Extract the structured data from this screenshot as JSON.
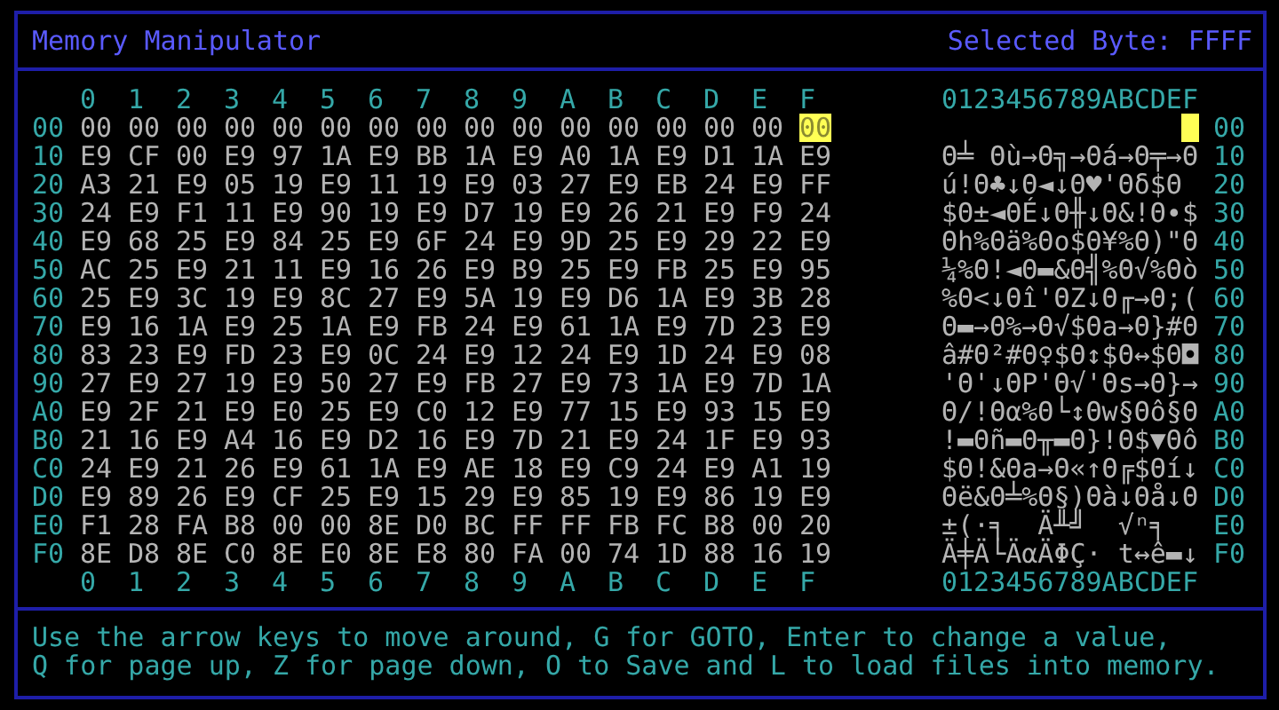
{
  "header": {
    "title": "Memory Manipulator",
    "selected_byte": "Selected Byte: FFFF"
  },
  "columns": [
    "0",
    "1",
    "2",
    "3",
    "4",
    "5",
    "6",
    "7",
    "8",
    "9",
    "A",
    "B",
    "C",
    "D",
    "E",
    "F"
  ],
  "ascii_header": "0123456789ABCDEF",
  "rows": [
    {
      "label": "00",
      "right_label": "00",
      "ascii": "                ",
      "bytes": [
        {
          "hex": "00",
          "selected": false
        },
        {
          "hex": "00",
          "selected": false
        },
        {
          "hex": "00",
          "selected": false
        },
        {
          "hex": "00",
          "selected": false
        },
        {
          "hex": "00",
          "selected": false
        },
        {
          "hex": "00",
          "selected": false
        },
        {
          "hex": "00",
          "selected": false
        },
        {
          "hex": "00",
          "selected": false
        },
        {
          "hex": "00",
          "selected": false
        },
        {
          "hex": "00",
          "selected": false
        },
        {
          "hex": "00",
          "selected": false
        },
        {
          "hex": "00",
          "selected": false
        },
        {
          "hex": "00",
          "selected": false
        },
        {
          "hex": "00",
          "selected": false
        },
        {
          "hex": "00",
          "selected": false
        },
        {
          "hex": "00",
          "selected": true
        }
      ]
    },
    {
      "label": "10",
      "right_label": "10",
      "ascii": "Θ╧ Θù→Θ╗→Θá→Θ╤→Θ",
      "bytes": [
        {
          "hex": "E9",
          "selected": false
        },
        {
          "hex": "CF",
          "selected": false
        },
        {
          "hex": "00",
          "selected": false
        },
        {
          "hex": "E9",
          "selected": false
        },
        {
          "hex": "97",
          "selected": false
        },
        {
          "hex": "1A",
          "selected": false
        },
        {
          "hex": "E9",
          "selected": false
        },
        {
          "hex": "BB",
          "selected": false
        },
        {
          "hex": "1A",
          "selected": false
        },
        {
          "hex": "E9",
          "selected": false
        },
        {
          "hex": "A0",
          "selected": false
        },
        {
          "hex": "1A",
          "selected": false
        },
        {
          "hex": "E9",
          "selected": false
        },
        {
          "hex": "D1",
          "selected": false
        },
        {
          "hex": "1A",
          "selected": false
        },
        {
          "hex": "E9",
          "selected": false
        }
      ]
    },
    {
      "label": "20",
      "right_label": "20",
      "ascii": "ú!Θ♣↓Θ◄↓Θ♥'Θδ$Θ ",
      "bytes": [
        {
          "hex": "A3",
          "selected": false
        },
        {
          "hex": "21",
          "selected": false
        },
        {
          "hex": "E9",
          "selected": false
        },
        {
          "hex": "05",
          "selected": false
        },
        {
          "hex": "19",
          "selected": false
        },
        {
          "hex": "E9",
          "selected": false
        },
        {
          "hex": "11",
          "selected": false
        },
        {
          "hex": "19",
          "selected": false
        },
        {
          "hex": "E9",
          "selected": false
        },
        {
          "hex": "03",
          "selected": false
        },
        {
          "hex": "27",
          "selected": false
        },
        {
          "hex": "E9",
          "selected": false
        },
        {
          "hex": "EB",
          "selected": false
        },
        {
          "hex": "24",
          "selected": false
        },
        {
          "hex": "E9",
          "selected": false
        },
        {
          "hex": "FF",
          "selected": false
        }
      ]
    },
    {
      "label": "30",
      "right_label": "30",
      "ascii": "$Θ±◄ΘÉ↓Θ╫↓Θ&!Θ∙$",
      "bytes": [
        {
          "hex": "24",
          "selected": false
        },
        {
          "hex": "E9",
          "selected": false
        },
        {
          "hex": "F1",
          "selected": false
        },
        {
          "hex": "11",
          "selected": false
        },
        {
          "hex": "E9",
          "selected": false
        },
        {
          "hex": "90",
          "selected": false
        },
        {
          "hex": "19",
          "selected": false
        },
        {
          "hex": "E9",
          "selected": false
        },
        {
          "hex": "D7",
          "selected": false
        },
        {
          "hex": "19",
          "selected": false
        },
        {
          "hex": "E9",
          "selected": false
        },
        {
          "hex": "26",
          "selected": false
        },
        {
          "hex": "21",
          "selected": false
        },
        {
          "hex": "E9",
          "selected": false
        },
        {
          "hex": "F9",
          "selected": false
        },
        {
          "hex": "24",
          "selected": false
        }
      ]
    },
    {
      "label": "40",
      "right_label": "40",
      "ascii": "Θh%Θä%Θo$Θ¥%Θ)\"Θ",
      "bytes": [
        {
          "hex": "E9",
          "selected": false
        },
        {
          "hex": "68",
          "selected": false
        },
        {
          "hex": "25",
          "selected": false
        },
        {
          "hex": "E9",
          "selected": false
        },
        {
          "hex": "84",
          "selected": false
        },
        {
          "hex": "25",
          "selected": false
        },
        {
          "hex": "E9",
          "selected": false
        },
        {
          "hex": "6F",
          "selected": false
        },
        {
          "hex": "24",
          "selected": false
        },
        {
          "hex": "E9",
          "selected": false
        },
        {
          "hex": "9D",
          "selected": false
        },
        {
          "hex": "25",
          "selected": false
        },
        {
          "hex": "E9",
          "selected": false
        },
        {
          "hex": "29",
          "selected": false
        },
        {
          "hex": "22",
          "selected": false
        },
        {
          "hex": "E9",
          "selected": false
        }
      ]
    },
    {
      "label": "50",
      "right_label": "50",
      "ascii": "¼%Θ!◄Θ▬&Θ╣%Θ√%Θò",
      "bytes": [
        {
          "hex": "AC",
          "selected": false
        },
        {
          "hex": "25",
          "selected": false
        },
        {
          "hex": "E9",
          "selected": false
        },
        {
          "hex": "21",
          "selected": false
        },
        {
          "hex": "11",
          "selected": false
        },
        {
          "hex": "E9",
          "selected": false
        },
        {
          "hex": "16",
          "selected": false
        },
        {
          "hex": "26",
          "selected": false
        },
        {
          "hex": "E9",
          "selected": false
        },
        {
          "hex": "B9",
          "selected": false
        },
        {
          "hex": "25",
          "selected": false
        },
        {
          "hex": "E9",
          "selected": false
        },
        {
          "hex": "FB",
          "selected": false
        },
        {
          "hex": "25",
          "selected": false
        },
        {
          "hex": "E9",
          "selected": false
        },
        {
          "hex": "95",
          "selected": false
        }
      ]
    },
    {
      "label": "60",
      "right_label": "60",
      "ascii": "%Θ<↓Θî'ΘZ↓Θ╓→Θ;(",
      "bytes": [
        {
          "hex": "25",
          "selected": false
        },
        {
          "hex": "E9",
          "selected": false
        },
        {
          "hex": "3C",
          "selected": false
        },
        {
          "hex": "19",
          "selected": false
        },
        {
          "hex": "E9",
          "selected": false
        },
        {
          "hex": "8C",
          "selected": false
        },
        {
          "hex": "27",
          "selected": false
        },
        {
          "hex": "E9",
          "selected": false
        },
        {
          "hex": "5A",
          "selected": false
        },
        {
          "hex": "19",
          "selected": false
        },
        {
          "hex": "E9",
          "selected": false
        },
        {
          "hex": "D6",
          "selected": false
        },
        {
          "hex": "1A",
          "selected": false
        },
        {
          "hex": "E9",
          "selected": false
        },
        {
          "hex": "3B",
          "selected": false
        },
        {
          "hex": "28",
          "selected": false
        }
      ]
    },
    {
      "label": "70",
      "right_label": "70",
      "ascii": "Θ▬→Θ%→Θ√$Θa→Θ}#Θ",
      "bytes": [
        {
          "hex": "E9",
          "selected": false
        },
        {
          "hex": "16",
          "selected": false
        },
        {
          "hex": "1A",
          "selected": false
        },
        {
          "hex": "E9",
          "selected": false
        },
        {
          "hex": "25",
          "selected": false
        },
        {
          "hex": "1A",
          "selected": false
        },
        {
          "hex": "E9",
          "selected": false
        },
        {
          "hex": "FB",
          "selected": false
        },
        {
          "hex": "24",
          "selected": false
        },
        {
          "hex": "E9",
          "selected": false
        },
        {
          "hex": "61",
          "selected": false
        },
        {
          "hex": "1A",
          "selected": false
        },
        {
          "hex": "E9",
          "selected": false
        },
        {
          "hex": "7D",
          "selected": false
        },
        {
          "hex": "23",
          "selected": false
        },
        {
          "hex": "E9",
          "selected": false
        }
      ]
    },
    {
      "label": "80",
      "right_label": "80",
      "ascii": "â#Θ²#Θ♀$Θ↕$Θ↔$Θ◘",
      "bytes": [
        {
          "hex": "83",
          "selected": false
        },
        {
          "hex": "23",
          "selected": false
        },
        {
          "hex": "E9",
          "selected": false
        },
        {
          "hex": "FD",
          "selected": false
        },
        {
          "hex": "23",
          "selected": false
        },
        {
          "hex": "E9",
          "selected": false
        },
        {
          "hex": "0C",
          "selected": false
        },
        {
          "hex": "24",
          "selected": false
        },
        {
          "hex": "E9",
          "selected": false
        },
        {
          "hex": "12",
          "selected": false
        },
        {
          "hex": "24",
          "selected": false
        },
        {
          "hex": "E9",
          "selected": false
        },
        {
          "hex": "1D",
          "selected": false
        },
        {
          "hex": "24",
          "selected": false
        },
        {
          "hex": "E9",
          "selected": false
        },
        {
          "hex": "08",
          "selected": false
        }
      ]
    },
    {
      "label": "90",
      "right_label": "90",
      "ascii": "'Θ'↓ΘP'Θ√'Θs→Θ}→",
      "bytes": [
        {
          "hex": "27",
          "selected": false
        },
        {
          "hex": "E9",
          "selected": false
        },
        {
          "hex": "27",
          "selected": false
        },
        {
          "hex": "19",
          "selected": false
        },
        {
          "hex": "E9",
          "selected": false
        },
        {
          "hex": "50",
          "selected": false
        },
        {
          "hex": "27",
          "selected": false
        },
        {
          "hex": "E9",
          "selected": false
        },
        {
          "hex": "FB",
          "selected": false
        },
        {
          "hex": "27",
          "selected": false
        },
        {
          "hex": "E9",
          "selected": false
        },
        {
          "hex": "73",
          "selected": false
        },
        {
          "hex": "1A",
          "selected": false
        },
        {
          "hex": "E9",
          "selected": false
        },
        {
          "hex": "7D",
          "selected": false
        },
        {
          "hex": "1A",
          "selected": false
        }
      ]
    },
    {
      "label": "A0",
      "right_label": "A0",
      "ascii": "Θ/!Θα%Θ└↕Θw§Θô§Θ",
      "bytes": [
        {
          "hex": "E9",
          "selected": false
        },
        {
          "hex": "2F",
          "selected": false
        },
        {
          "hex": "21",
          "selected": false
        },
        {
          "hex": "E9",
          "selected": false
        },
        {
          "hex": "E0",
          "selected": false
        },
        {
          "hex": "25",
          "selected": false
        },
        {
          "hex": "E9",
          "selected": false
        },
        {
          "hex": "C0",
          "selected": false
        },
        {
          "hex": "12",
          "selected": false
        },
        {
          "hex": "E9",
          "selected": false
        },
        {
          "hex": "77",
          "selected": false
        },
        {
          "hex": "15",
          "selected": false
        },
        {
          "hex": "E9",
          "selected": false
        },
        {
          "hex": "93",
          "selected": false
        },
        {
          "hex": "15",
          "selected": false
        },
        {
          "hex": "E9",
          "selected": false
        }
      ]
    },
    {
      "label": "B0",
      "right_label": "B0",
      "ascii": "!▬Θñ▬Θ╥▬Θ}!Θ$▼Θô",
      "bytes": [
        {
          "hex": "21",
          "selected": false
        },
        {
          "hex": "16",
          "selected": false
        },
        {
          "hex": "E9",
          "selected": false
        },
        {
          "hex": "A4",
          "selected": false
        },
        {
          "hex": "16",
          "selected": false
        },
        {
          "hex": "E9",
          "selected": false
        },
        {
          "hex": "D2",
          "selected": false
        },
        {
          "hex": "16",
          "selected": false
        },
        {
          "hex": "E9",
          "selected": false
        },
        {
          "hex": "7D",
          "selected": false
        },
        {
          "hex": "21",
          "selected": false
        },
        {
          "hex": "E9",
          "selected": false
        },
        {
          "hex": "24",
          "selected": false
        },
        {
          "hex": "1F",
          "selected": false
        },
        {
          "hex": "E9",
          "selected": false
        },
        {
          "hex": "93",
          "selected": false
        }
      ]
    },
    {
      "label": "C0",
      "right_label": "C0",
      "ascii": "$Θ!&Θa→Θ«↑Θ╔$Θí↓",
      "bytes": [
        {
          "hex": "24",
          "selected": false
        },
        {
          "hex": "E9",
          "selected": false
        },
        {
          "hex": "21",
          "selected": false
        },
        {
          "hex": "26",
          "selected": false
        },
        {
          "hex": "E9",
          "selected": false
        },
        {
          "hex": "61",
          "selected": false
        },
        {
          "hex": "1A",
          "selected": false
        },
        {
          "hex": "E9",
          "selected": false
        },
        {
          "hex": "AE",
          "selected": false
        },
        {
          "hex": "18",
          "selected": false
        },
        {
          "hex": "E9",
          "selected": false
        },
        {
          "hex": "C9",
          "selected": false
        },
        {
          "hex": "24",
          "selected": false
        },
        {
          "hex": "E9",
          "selected": false
        },
        {
          "hex": "A1",
          "selected": false
        },
        {
          "hex": "19",
          "selected": false
        }
      ]
    },
    {
      "label": "D0",
      "right_label": "D0",
      "ascii": "Θë&Θ╧%Θ§)Θà↓Θå↓Θ",
      "bytes": [
        {
          "hex": "E9",
          "selected": false
        },
        {
          "hex": "89",
          "selected": false
        },
        {
          "hex": "26",
          "selected": false
        },
        {
          "hex": "E9",
          "selected": false
        },
        {
          "hex": "CF",
          "selected": false
        },
        {
          "hex": "25",
          "selected": false
        },
        {
          "hex": "E9",
          "selected": false
        },
        {
          "hex": "15",
          "selected": false
        },
        {
          "hex": "29",
          "selected": false
        },
        {
          "hex": "E9",
          "selected": false
        },
        {
          "hex": "85",
          "selected": false
        },
        {
          "hex": "19",
          "selected": false
        },
        {
          "hex": "E9",
          "selected": false
        },
        {
          "hex": "86",
          "selected": false
        },
        {
          "hex": "19",
          "selected": false
        },
        {
          "hex": "E9",
          "selected": false
        }
      ]
    },
    {
      "label": "E0",
      "right_label": "E0",
      "ascii": "±(·╕  Ä╨╝  √ⁿ╕  ",
      "bytes": [
        {
          "hex": "F1",
          "selected": false
        },
        {
          "hex": "28",
          "selected": false
        },
        {
          "hex": "FA",
          "selected": false
        },
        {
          "hex": "B8",
          "selected": false
        },
        {
          "hex": "00",
          "selected": false
        },
        {
          "hex": "00",
          "selected": false
        },
        {
          "hex": "8E",
          "selected": false
        },
        {
          "hex": "D0",
          "selected": false
        },
        {
          "hex": "BC",
          "selected": false
        },
        {
          "hex": "FF",
          "selected": false
        },
        {
          "hex": "FF",
          "selected": false
        },
        {
          "hex": "FB",
          "selected": false
        },
        {
          "hex": "FC",
          "selected": false
        },
        {
          "hex": "B8",
          "selected": false
        },
        {
          "hex": "00",
          "selected": false
        },
        {
          "hex": "20",
          "selected": false
        }
      ]
    },
    {
      "label": "F0",
      "right_label": "F0",
      "ascii": "Ä╪Ä└ÄαÄΦÇ· t↔ê▬↓",
      "bytes": [
        {
          "hex": "8E",
          "selected": false
        },
        {
          "hex": "D8",
          "selected": false
        },
        {
          "hex": "8E",
          "selected": false
        },
        {
          "hex": "C0",
          "selected": false
        },
        {
          "hex": "8E",
          "selected": false
        },
        {
          "hex": "E0",
          "selected": false
        },
        {
          "hex": "8E",
          "selected": false
        },
        {
          "hex": "E8",
          "selected": false
        },
        {
          "hex": "80",
          "selected": false
        },
        {
          "hex": "FA",
          "selected": false
        },
        {
          "hex": "00",
          "selected": false
        },
        {
          "hex": "74",
          "selected": false
        },
        {
          "hex": "1D",
          "selected": false
        },
        {
          "hex": "88",
          "selected": false
        },
        {
          "hex": "16",
          "selected": false
        },
        {
          "hex": "19",
          "selected": false
        }
      ]
    }
  ],
  "bottom_columns": [
    "0",
    "1",
    "2",
    "3",
    "4",
    "5",
    "6",
    "7",
    "8",
    "9",
    "A",
    "B",
    "C",
    "D",
    "E",
    "F"
  ],
  "bottom_ascii_header": "0123456789ABCDEF",
  "help_lines": [
    "Use the arrow keys to move around, G for GOTO, Enter to change a value,",
    "Q for page up, Z for page down, O to Save and L to load files into memory."
  ]
}
